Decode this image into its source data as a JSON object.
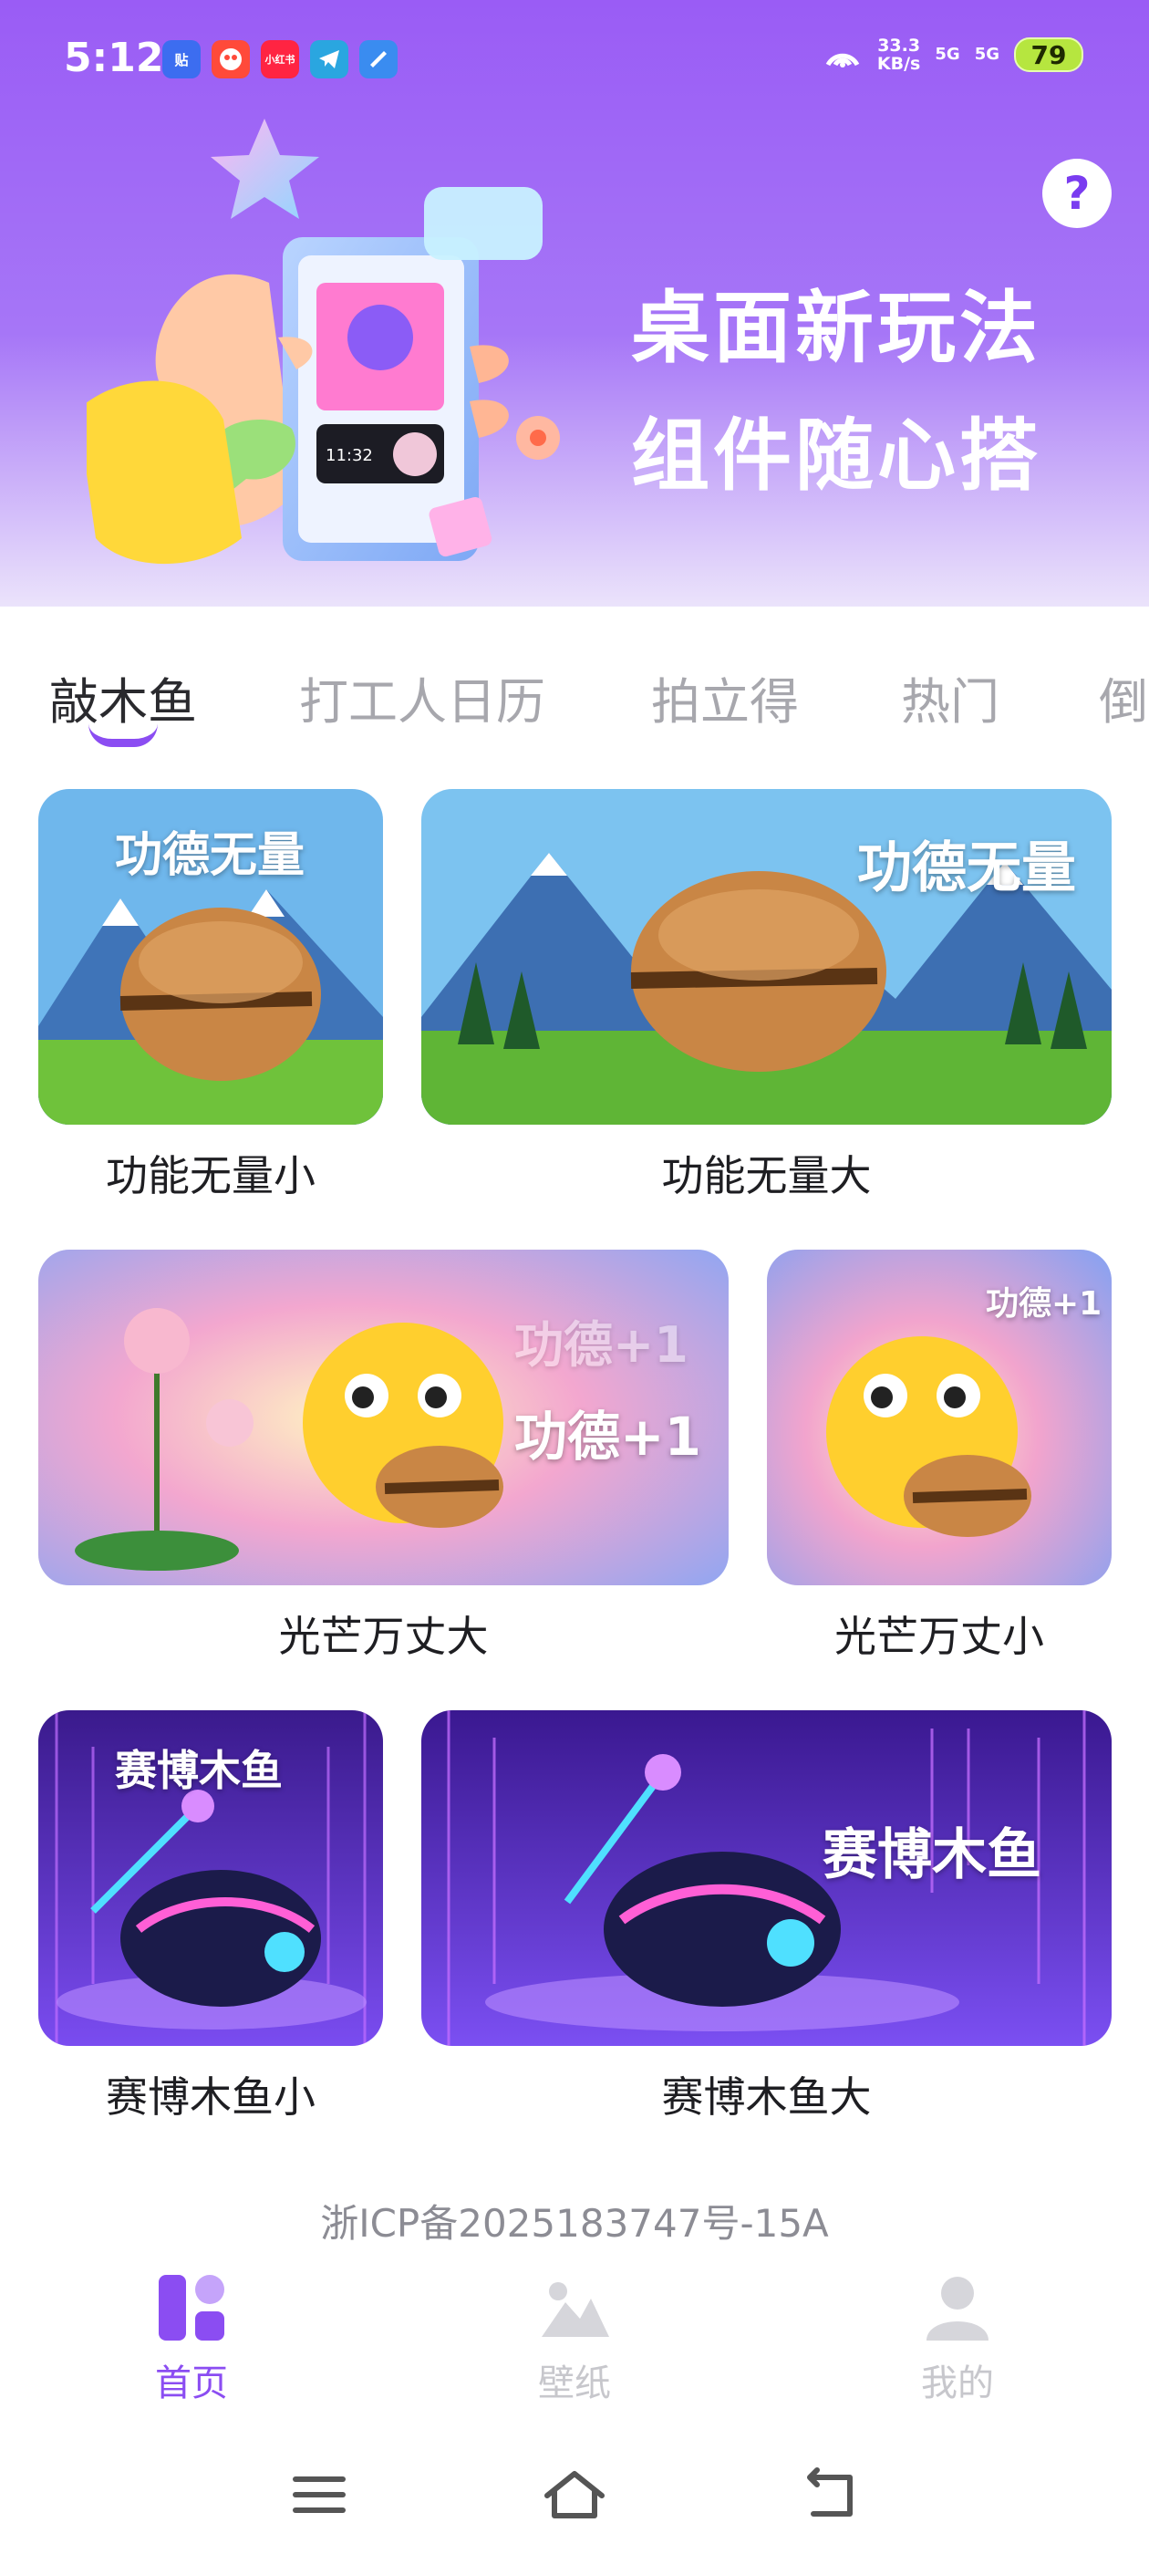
{
  "status_bar": {
    "time": "5:12",
    "net_speed_value": "33.3",
    "net_speed_unit": "KB/s",
    "signal1": "5G",
    "signal2": "5G",
    "battery": "79",
    "apps": [
      {
        "name": "tieba-app-icon",
        "text": "贴",
        "color": "#3c6df0"
      },
      {
        "name": "game-app-icon",
        "text": "",
        "color": "#ff4a3a"
      },
      {
        "name": "xiaohongshu-app-icon",
        "text": "小红书",
        "color": "#ff2442"
      },
      {
        "name": "telegram-app-icon",
        "text": "",
        "color": "#2aa6e0"
      },
      {
        "name": "blue-app-icon",
        "text": "",
        "color": "#3a8cf0"
      }
    ]
  },
  "banner": {
    "headline_line1": "桌面新玩法",
    "headline_line2": "组件随心搭",
    "help": "?",
    "phone_clock": "11:32"
  },
  "tabs": [
    "敲木鱼",
    "打工人日历",
    "拍立得",
    "热门",
    "倒"
  ],
  "cards": [
    {
      "label": "功能无量小",
      "overlay": "功德无量"
    },
    {
      "label": "功能无量大",
      "overlay": "功德无量"
    },
    {
      "label": "光芒万丈大",
      "overlay": "功德+1",
      "overlay_faded": "功德+1"
    },
    {
      "label": "光芒万丈小",
      "overlay": "功德+1"
    },
    {
      "label": "赛博木鱼小",
      "overlay": "赛博木鱼"
    },
    {
      "label": "赛博木鱼大",
      "overlay": "赛博木鱼"
    }
  ],
  "footer": {
    "icp": "浙ICP备2025183747号-15A"
  },
  "bottom_nav": [
    {
      "label": "首页",
      "active": true
    },
    {
      "label": "壁纸",
      "active": false
    },
    {
      "label": "我的",
      "active": false
    }
  ],
  "colors": {
    "accent": "#8b4df2",
    "banner_top": "#9a5cf5"
  }
}
